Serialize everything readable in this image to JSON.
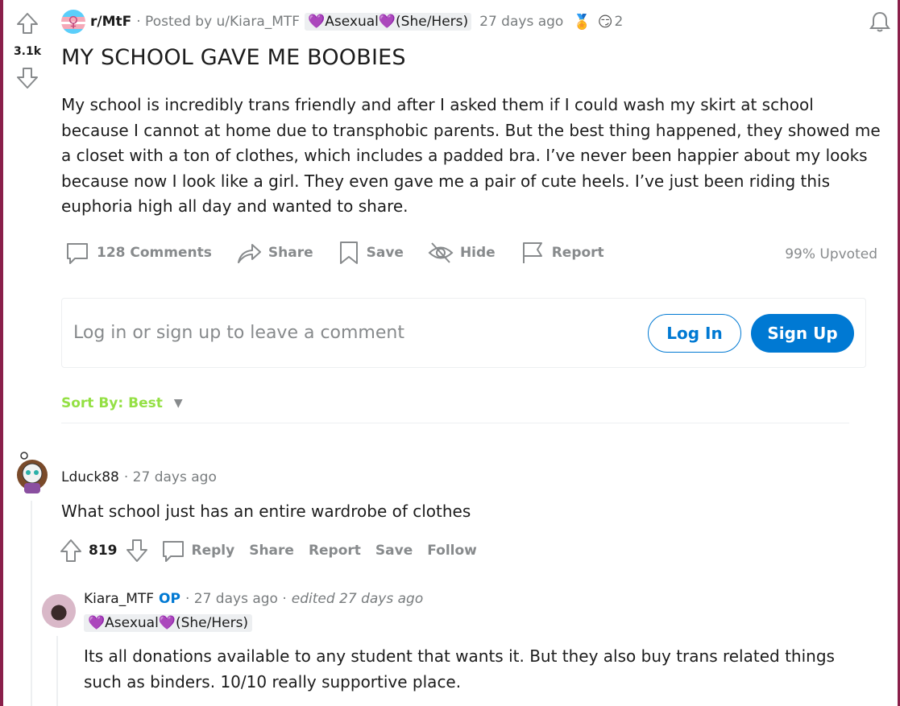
{
  "post": {
    "votes": "3.1k",
    "subreddit": "r/MtF",
    "posted_by": "· Posted by u/Kiara_MTF",
    "flair": "💜Asexual💜(She/Hers)",
    "time": "27 days ago",
    "award_count": "2",
    "title": "MY SCHOOL GAVE ME BOOBIES",
    "body": "My school is incredibly trans friendly and after I asked them if I could wash my skirt at school because I cannot at home due to transphobic parents. But the best thing happened, they showed me a closet with a ton of clothes, which includes a padded bra. I’ve never been happier about my looks because now I look like a girl. They even gave me a pair of cute heels. I’ve just been riding this euphoria high all day and wanted to share.",
    "actions": {
      "comments": "128 Comments",
      "share": "Share",
      "save": "Save",
      "hide": "Hide",
      "report": "Report"
    },
    "upvoted": "99% Upvoted"
  },
  "login_prompt": {
    "text": "Log in or sign up to leave a comment",
    "login": "Log In",
    "signup": "Sign Up"
  },
  "sort": {
    "label": "Sort By: Best"
  },
  "comments": [
    {
      "author": "Lduck88",
      "time": "· 27 days ago",
      "body": "What school just has an entire wardrobe of clothes",
      "score": "819",
      "actions": [
        "Reply",
        "Share",
        "Report",
        "Save",
        "Follow"
      ]
    },
    {
      "author": "Kiara_MTF",
      "op": "OP",
      "time": "· 27 days ago ·",
      "edited": "edited 27 days ago",
      "flair": "💜Asexual💜(She/Hers)",
      "body": "Its all donations available to any student that wants it. But they also buy trans related things such as binders. 10/10 really supportive place."
    }
  ],
  "colors": {
    "accent": "#0079d3",
    "sort": "#94e044",
    "frame": "#8a1f4a",
    "muted": "#878a8c"
  }
}
